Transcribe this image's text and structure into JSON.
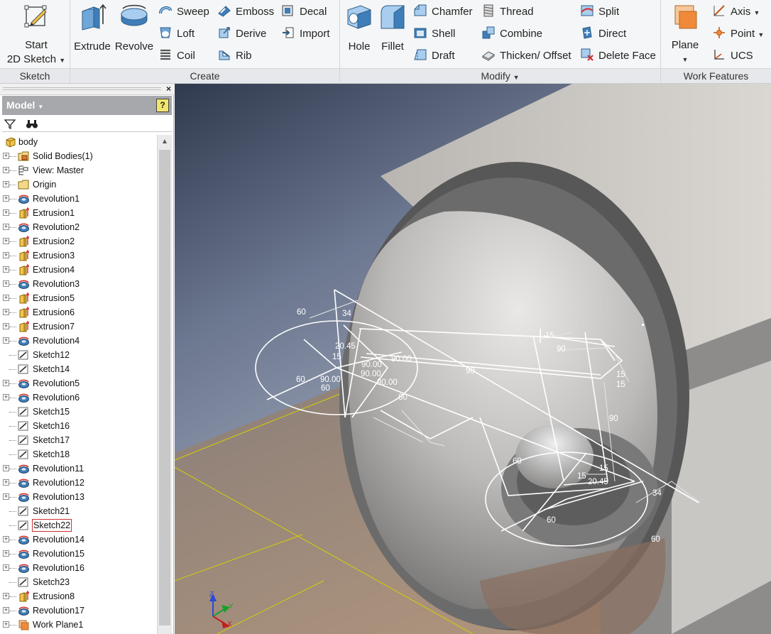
{
  "ribbon": {
    "sketch_panel": {
      "title": "Sketch",
      "start_sketch_line1": "Start",
      "start_sketch_line2": "2D Sketch"
    },
    "create_panel": {
      "title": "Create",
      "extrude": "Extrude",
      "revolve": "Revolve",
      "sweep": "Sweep",
      "loft": "Loft",
      "coil": "Coil",
      "emboss": "Emboss",
      "derive": "Derive",
      "rib": "Rib",
      "decal": "Decal",
      "import": "Import"
    },
    "modify_panel": {
      "title": "Modify",
      "hole": "Hole",
      "fillet": "Fillet",
      "chamfer": "Chamfer",
      "shell": "Shell",
      "draft": "Draft",
      "thread": "Thread",
      "combine": "Combine",
      "thicken": "Thicken/ Offset",
      "split": "Split",
      "direct": "Direct",
      "delete_face": "Delete Face"
    },
    "work_panel": {
      "title": "Work Features",
      "plane": "Plane",
      "axis": "Axis",
      "point": "Point",
      "ucs": "UCS"
    }
  },
  "browser": {
    "header": "Model",
    "help": "?",
    "tree": [
      {
        "label": "body",
        "icon": "part-icon",
        "root": true
      },
      {
        "label": "Solid Bodies(1)",
        "icon": "solid-bodies-icon",
        "expander": true
      },
      {
        "label": "View: Master",
        "icon": "view-icon",
        "expander": true
      },
      {
        "label": "Origin",
        "icon": "folder-icon",
        "expander": true
      },
      {
        "label": "Revolution1",
        "icon": "revolve-feature-icon",
        "expander": true
      },
      {
        "label": "Extrusion1",
        "icon": "extrude-feature-icon",
        "expander": true
      },
      {
        "label": "Revolution2",
        "icon": "revolve-feature-icon",
        "expander": true
      },
      {
        "label": "Extrusion2",
        "icon": "extrude-feature-icon",
        "expander": true
      },
      {
        "label": "Extrusion3",
        "icon": "extrude-feature-icon",
        "expander": true
      },
      {
        "label": "Extrusion4",
        "icon": "extrude-feature-icon",
        "expander": true
      },
      {
        "label": "Revolution3",
        "icon": "revolve-feature-icon",
        "expander": true
      },
      {
        "label": "Extrusion5",
        "icon": "extrude-feature-icon",
        "expander": true
      },
      {
        "label": "Extrusion6",
        "icon": "extrude-feature-icon",
        "expander": true
      },
      {
        "label": "Extrusion7",
        "icon": "extrude-feature-icon",
        "expander": true
      },
      {
        "label": "Revolution4",
        "icon": "revolve-feature-icon",
        "expander": true
      },
      {
        "label": "Sketch12",
        "icon": "sketch-icon",
        "expander": false
      },
      {
        "label": "Sketch14",
        "icon": "sketch-icon",
        "expander": false
      },
      {
        "label": "Revolution5",
        "icon": "revolve-feature-icon",
        "expander": true
      },
      {
        "label": "Revolution6",
        "icon": "revolve-feature-icon",
        "expander": true
      },
      {
        "label": "Sketch15",
        "icon": "sketch-icon",
        "expander": false
      },
      {
        "label": "Sketch16",
        "icon": "sketch-icon",
        "expander": false
      },
      {
        "label": "Sketch17",
        "icon": "sketch-icon",
        "expander": false
      },
      {
        "label": "Sketch18",
        "icon": "sketch-icon",
        "expander": false
      },
      {
        "label": "Revolution11",
        "icon": "revolve-feature-icon",
        "expander": true
      },
      {
        "label": "Revolution12",
        "icon": "revolve-feature-icon",
        "expander": true
      },
      {
        "label": "Revolution13",
        "icon": "revolve-feature-icon",
        "expander": true
      },
      {
        "label": "Sketch21",
        "icon": "sketch-icon",
        "expander": false
      },
      {
        "label": "Sketch22",
        "icon": "sketch-icon",
        "expander": false,
        "highlighted": true
      },
      {
        "label": "Revolution14",
        "icon": "revolve-feature-icon",
        "expander": true
      },
      {
        "label": "Revolution15",
        "icon": "revolve-feature-icon",
        "expander": true
      },
      {
        "label": "Revolution16",
        "icon": "revolve-feature-icon",
        "expander": true
      },
      {
        "label": "Sketch23",
        "icon": "sketch-icon",
        "expander": false
      },
      {
        "label": "Extrusion8",
        "icon": "extrude-feature-icon",
        "expander": true
      },
      {
        "label": "Revolution17",
        "icon": "revolve-feature-icon",
        "expander": true
      },
      {
        "label": "Work Plane1",
        "icon": "work-plane-icon",
        "expander": true
      }
    ]
  },
  "viewport": {
    "dimensions": {
      "d1": "60",
      "d2": "34",
      "d3": "15",
      "d4": "20.45",
      "d5": "90.00",
      "d6": "90.00",
      "d7": "60",
      "d8": "90.00",
      "d9": "60",
      "d10": "90.00",
      "d11": "60",
      "d12": "90",
      "d13": "15",
      "d14": "90",
      "d15": "15",
      "d16": "15",
      "d17": "90",
      "d18": "60",
      "d19": "15",
      "d20": "20.45",
      "d21": "34",
      "d22": "60",
      "d23": "60",
      "d24": "90.00",
      "d25": "15"
    },
    "triad": {
      "x": "X",
      "y": "Y",
      "z": "Z"
    }
  }
}
